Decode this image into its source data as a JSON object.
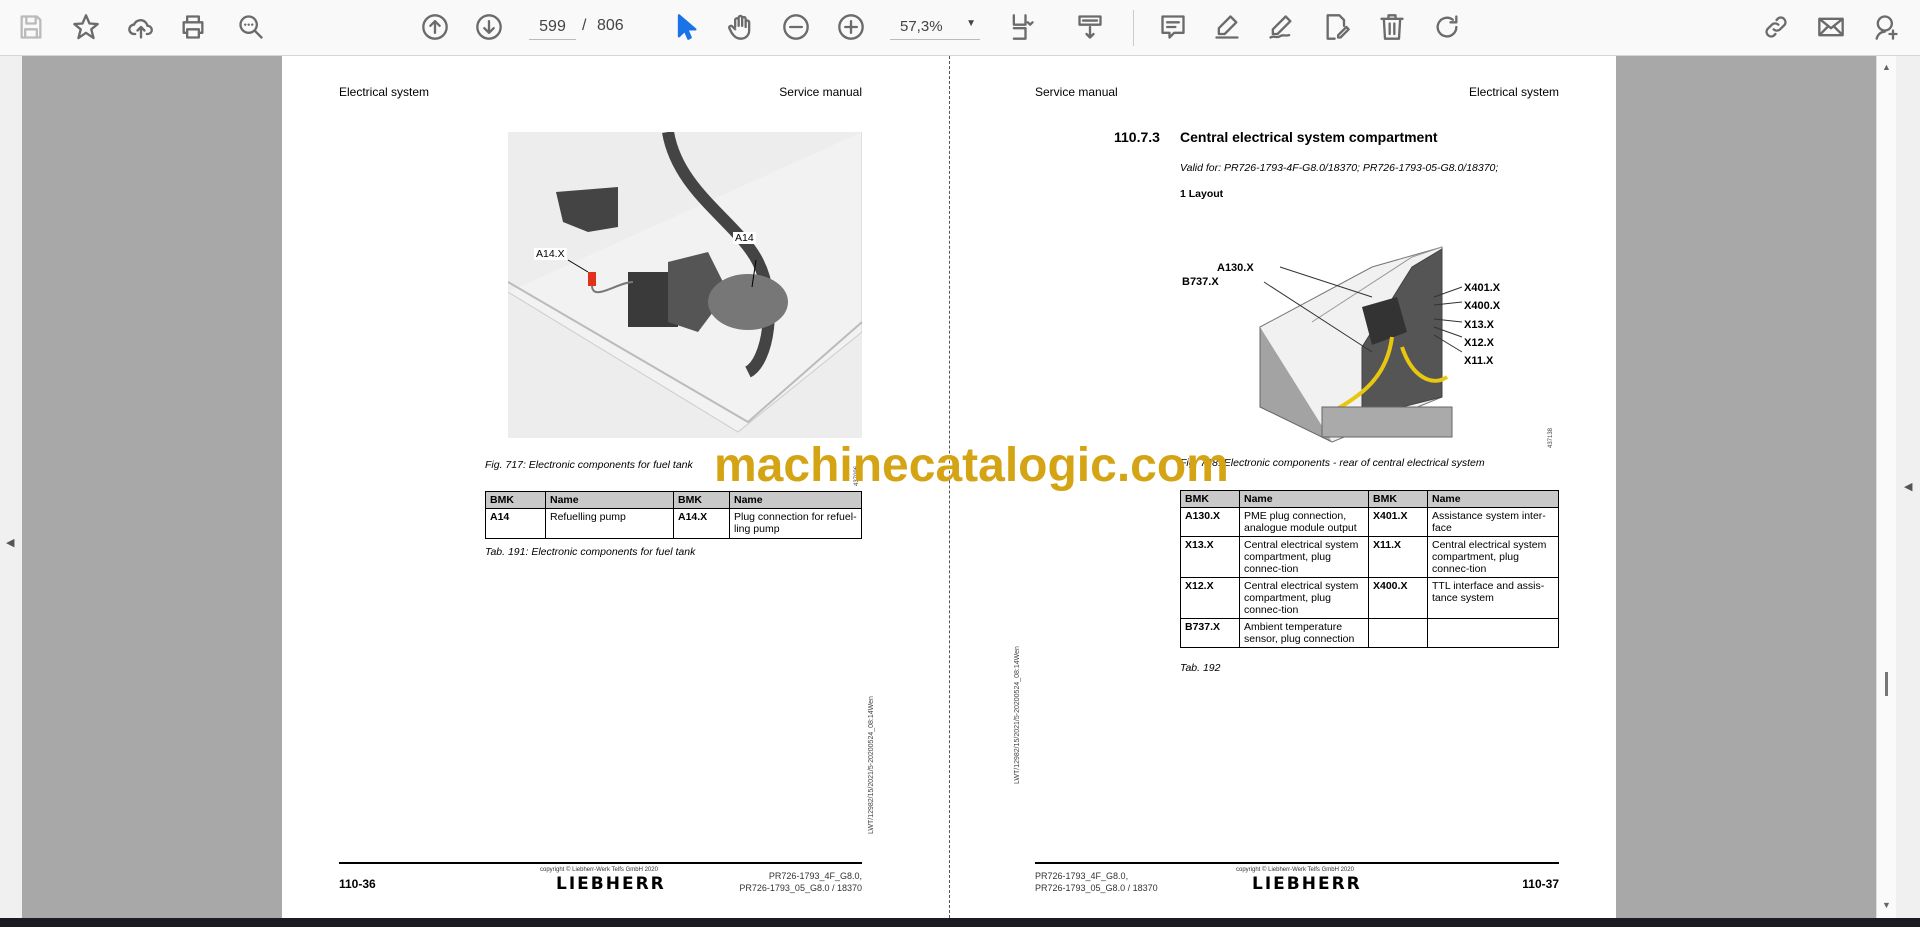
{
  "toolbar": {
    "page_current": "599",
    "page_separator": "/",
    "page_total": "806",
    "zoom": "57,3%",
    "icons": [
      "save-icon",
      "bookmark-star-icon",
      "upload-cloud-icon",
      "print-icon",
      "find-icon",
      "prev-page-icon",
      "next-page-icon",
      "select-cursor-icon",
      "hand-pan-icon",
      "zoom-out-icon",
      "zoom-in-icon",
      "fit-page-icon",
      "scroll-mode-icon",
      "comment-icon",
      "highlight-icon",
      "sign-icon",
      "edit-icon",
      "delete-icon",
      "rotate-icon",
      "share-link-icon",
      "email-icon",
      "account-icon"
    ],
    "accent": "#1a73e8"
  },
  "watermark": "machinecatalogic.com",
  "left_page": {
    "header_left": "Electrical system",
    "header_right": "Service manual",
    "figure": {
      "labels": [
        "A14.X",
        "A14"
      ],
      "id": "437096",
      "caption": "Fig. 717: Electronic components for fuel tank"
    },
    "table": {
      "headers": [
        "BMK",
        "Name",
        "BMK",
        "Name"
      ],
      "rows": [
        [
          "A14",
          "Refuelling pump",
          "A14.X",
          "Plug connection for refuel-ling pump"
        ]
      ]
    },
    "table_caption": "Tab. 191: Electronic components for fuel tank",
    "side_code": "LWT/12982/15/2021/5-20200524_08:14Wen",
    "footer": {
      "page": "110-36",
      "copyright": "copyright © Liebherr-Werk Telfs GmbH 2020",
      "logo": "LIEBHERR",
      "model_1": "PR726-1793_4F_G8.0,",
      "model_2": "PR726-1793_05_G8.0 / 18370"
    }
  },
  "right_page": {
    "header_left": "Service manual",
    "header_right": "Electrical system",
    "section_number": "110.7.3",
    "section_title": "Central electrical system compartment",
    "valid_for": "Valid for: PR726-1793-4F-G8.0/18370; PR726-1793-05-G8.0/18370;",
    "subheading": "1 Layout",
    "figure": {
      "labels": [
        "A130.X",
        "B737.X",
        "X401.X",
        "X400.X",
        "X13.X",
        "X12.X",
        "X11.X"
      ],
      "id": "437138",
      "caption": "Fig. 718: Electronic components - rear of central electrical system"
    },
    "table": {
      "headers": [
        "BMK",
        "Name",
        "BMK",
        "Name"
      ],
      "rows": [
        [
          "A130.X",
          "PME plug connection, analogue module output",
          "X401.X",
          "Assistance system inter-face"
        ],
        [
          "X13.X",
          "Central electrical system compartment, plug connec-tion",
          "X11.X",
          "Central electrical system compartment, plug connec-tion"
        ],
        [
          "X12.X",
          "Central electrical system compartment, plug connec-tion",
          "X400.X",
          "TTL interface and assis-tance system"
        ],
        [
          "B737.X",
          "Ambient temperature sensor, plug connection",
          "",
          ""
        ]
      ]
    },
    "table_caption": "Tab. 192",
    "side_code": "LWT/12982/15/2021/5-20200524_08:14Wen",
    "footer": {
      "page": "110-37",
      "copyright": "copyright © Liebherr-Werk Telfs GmbH 2020",
      "logo": "LIEBHERR",
      "model_1": "PR726-1793_4F_G8.0,",
      "model_2": "PR726-1793_05_G8.0 / 18370"
    }
  }
}
